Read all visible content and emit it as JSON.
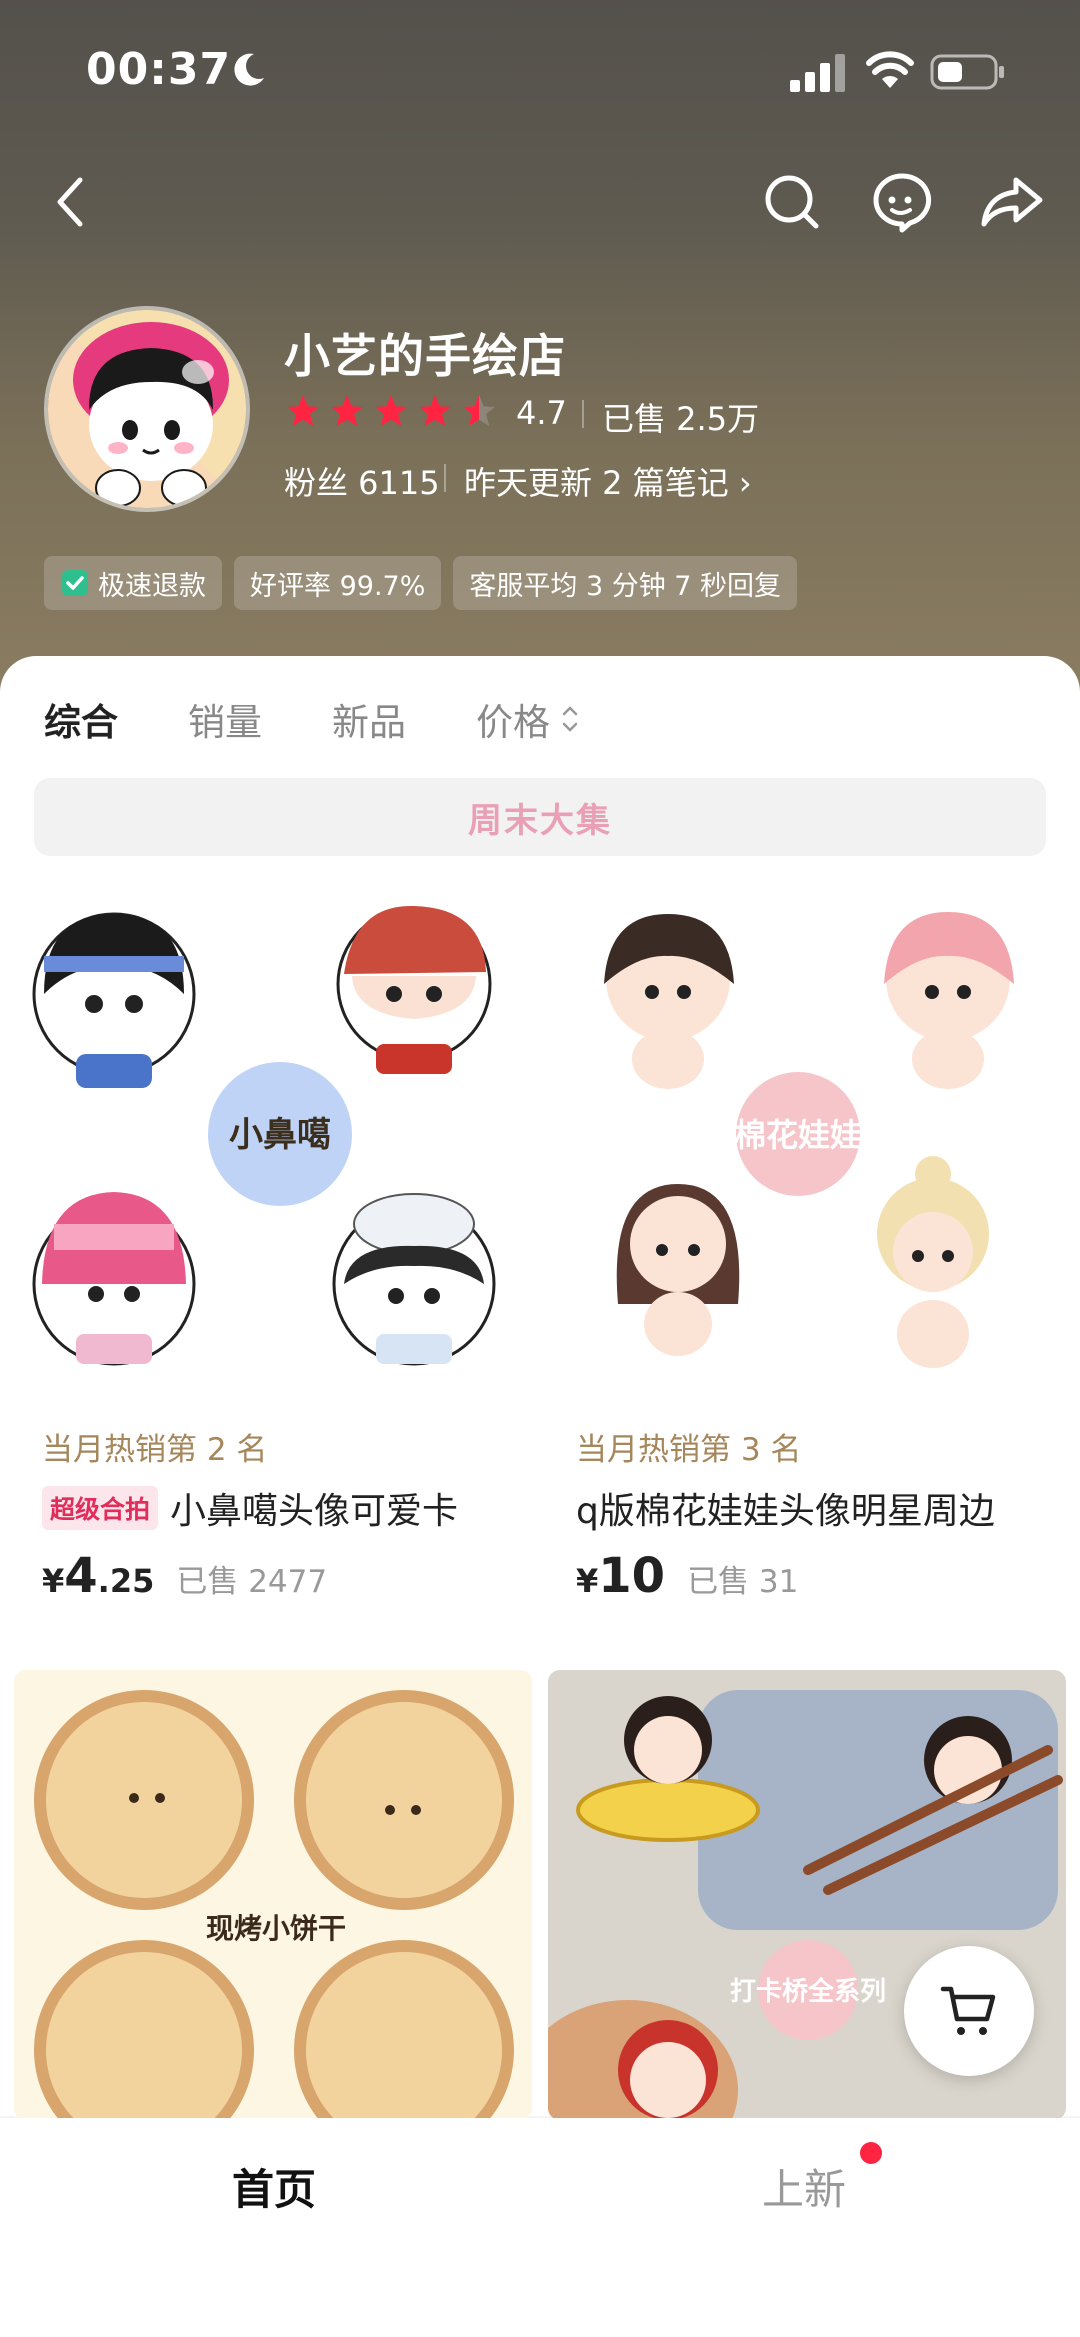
{
  "status_bar": {
    "time": "00:37"
  },
  "shop": {
    "name": "小艺的手绘店",
    "rating": "4.7",
    "sold": "已售 2.5万",
    "fans": "粉丝 6115",
    "update": "昨天更新 2 篇笔记 ›",
    "star_rating_value": 4.7
  },
  "badges": [
    {
      "label": "极速退款"
    },
    {
      "label": "好评率 99.7%"
    },
    {
      "label": "客服平均 3 分钟 7 秒回复"
    }
  ],
  "tabs": [
    {
      "label": "综合"
    },
    {
      "label": "销量"
    },
    {
      "label": "新品"
    },
    {
      "label": "价格"
    }
  ],
  "banner": {
    "label": "周末大集"
  },
  "products": [
    {
      "rank": "当月热销第 2 名",
      "tag": "超级合拍",
      "title": "小鼻噶头像可爱卡",
      "currency": "¥",
      "price_int": "4",
      "price_dec": ".25",
      "sold": "已售 2477",
      "image_caption": "小鼻噶"
    },
    {
      "rank": "当月热销第 3 名",
      "tag": "",
      "title": "q版棉花娃娃头像明星周边",
      "currency": "¥",
      "price_int": "10",
      "price_dec": "",
      "sold": "已售 31",
      "image_caption": "棉花娃娃"
    },
    {
      "image_caption": "现烤小饼干"
    },
    {
      "image_caption": "打卡桥全系列"
    }
  ],
  "bottom_nav": [
    {
      "label": "首页"
    },
    {
      "label": "上新"
    }
  ],
  "colors": {
    "accent_red": "#ff2442",
    "star": "#ff2442",
    "rank_text": "#a6865b",
    "banner_text": "#e9a0b6"
  }
}
